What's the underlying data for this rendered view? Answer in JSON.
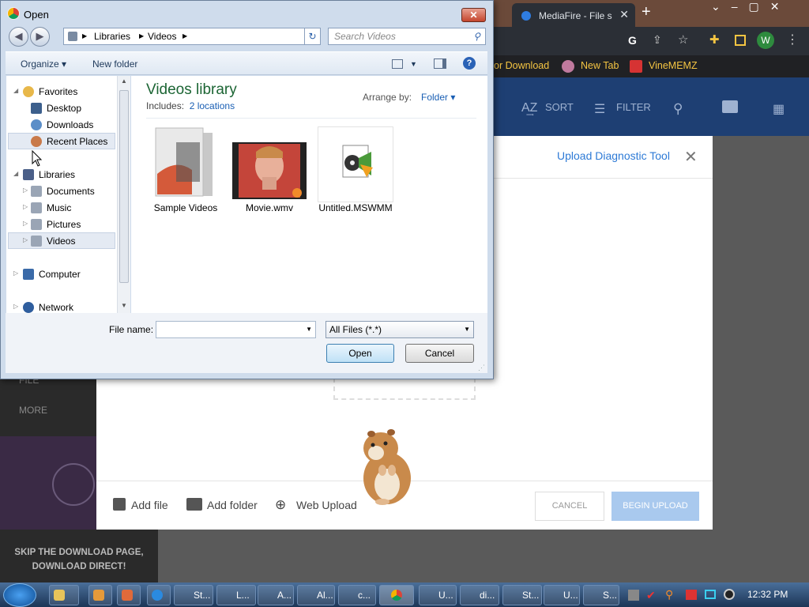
{
  "chrome": {
    "tab_title": "MediaFire - File s",
    "bookmarks": [
      "or Download",
      "New Tab",
      "VineMEMZ"
    ],
    "profile_initial": "W"
  },
  "mediafire": {
    "header_sort": "SORT",
    "header_filter": "FILTER",
    "sidebar_file": "FILE",
    "sidebar_more": "MORE",
    "skip_text": "SKIP THE DOWNLOAD PAGE, DOWNLOAD DIRECT!",
    "upload_diag": "Upload Diagnostic Tool",
    "add_file": "Add file",
    "add_folder": "Add folder",
    "web_upload": "Web Upload",
    "cancel": "CANCEL",
    "begin_upload": "BEGIN UPLOAD"
  },
  "dialog": {
    "title": "Open",
    "breadcrumb": [
      "Libraries",
      "Videos"
    ],
    "search_placeholder": "Search Videos",
    "organize": "Organize",
    "new_folder": "New folder",
    "tree": {
      "favorites": "Favorites",
      "desktop": "Desktop",
      "downloads": "Downloads",
      "recent_places": "Recent Places",
      "libraries": "Libraries",
      "documents": "Documents",
      "music": "Music",
      "pictures": "Pictures",
      "videos": "Videos",
      "computer": "Computer",
      "network": "Network"
    },
    "library_title": "Videos library",
    "includes_label": "Includes:",
    "includes_link": "2 locations",
    "arrange_label": "Arrange by:",
    "arrange_value": "Folder",
    "files": [
      {
        "name": "Sample Videos",
        "icon": "folder-icon"
      },
      {
        "name": "Movie.wmv",
        "icon": "video-thumbnail-icon"
      },
      {
        "name": "Untitled.MSWMM",
        "icon": "movie-maker-project-icon"
      }
    ],
    "file_name_label": "File name:",
    "file_name_value": "",
    "file_type": "All Files (*.*)",
    "open_button": "Open",
    "cancel_button": "Cancel"
  },
  "taskbar": {
    "items": [
      "St...",
      "L...",
      "A...",
      "Al...",
      "c...",
      "",
      "U...",
      "di...",
      "St...",
      "U...",
      "S..."
    ],
    "clock": "12:32 PM"
  },
  "colors": {
    "mediafire_blue": "#1e3f73",
    "link_blue": "#1a5fb4",
    "library_green": "#1c6534"
  }
}
